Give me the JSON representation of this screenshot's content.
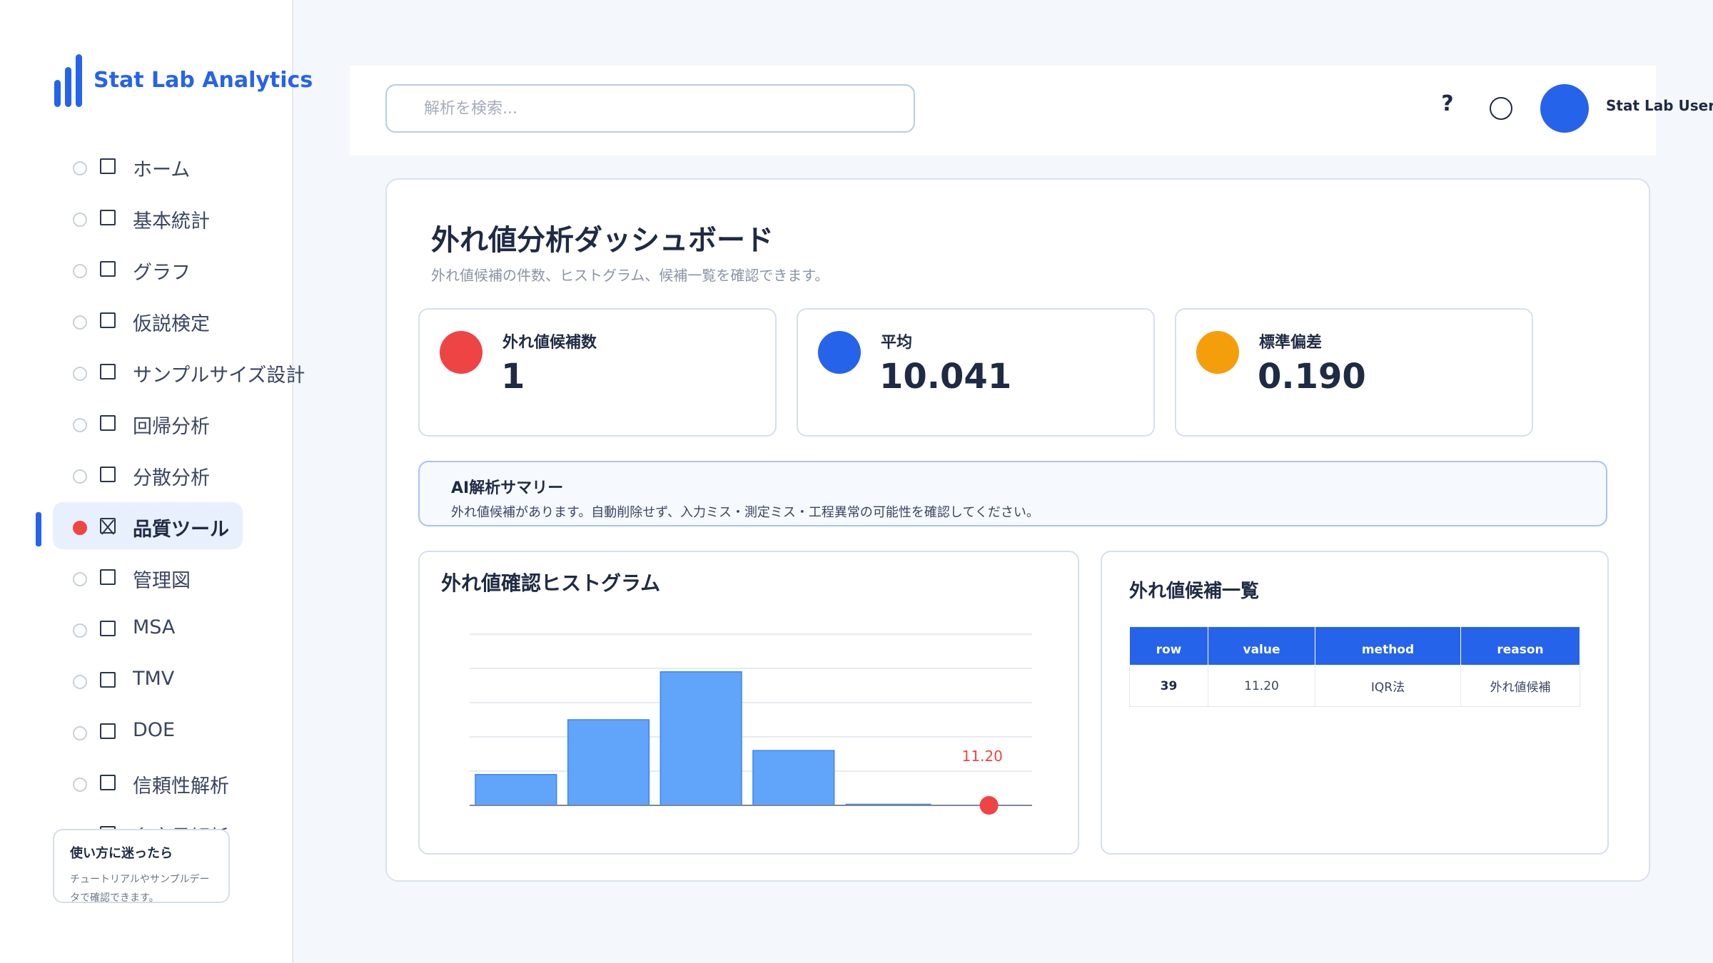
{
  "app": {
    "title": "Stat Lab Analytics"
  },
  "sidebar": {
    "items": [
      {
        "label": "ホーム",
        "active": false
      },
      {
        "label": "基本統計",
        "active": false
      },
      {
        "label": "グラフ",
        "active": false
      },
      {
        "label": "仮説検定",
        "active": false
      },
      {
        "label": "サンプルサイズ設計",
        "active": false
      },
      {
        "label": "回帰分析",
        "active": false
      },
      {
        "label": "分散分析",
        "active": false
      },
      {
        "label": "品質ツール",
        "active": true
      },
      {
        "label": "管理図",
        "active": false
      },
      {
        "label": "MSA",
        "active": false
      },
      {
        "label": "TMV",
        "active": false
      },
      {
        "label": "DOE",
        "active": false
      },
      {
        "label": "信頼性解析",
        "active": false
      },
      {
        "label": "多変量解析",
        "active": false
      }
    ],
    "help": {
      "title": "使い方に迷ったら",
      "text": "チュートリアルやサンプルデータで確認できます。"
    }
  },
  "header": {
    "search_placeholder": "解析を検索...",
    "help_icon": "?",
    "user_name": "Stat Lab User"
  },
  "colors": {
    "primary": "#2563eb",
    "danger": "#ef4444",
    "warning": "#f59e0b",
    "bar": "#60a5fa"
  },
  "dashboard": {
    "title": "外れ値分析ダッシュボード",
    "subtitle": "外れ値候補の件数、ヒストグラム、候補一覧を確認できます。",
    "stats": [
      {
        "label": "外れ値候補数",
        "value": "1",
        "color": "#ef4444"
      },
      {
        "label": "平均",
        "value": "10.041",
        "color": "#2563eb"
      },
      {
        "label": "標準偏差",
        "value": "0.190",
        "color": "#f59e0b"
      }
    ],
    "ai_summary": {
      "title": "AI解析サマリー",
      "text": "外れ値候補があります。自動削除せず、入力ミス・測定ミス・工程異常の可能性を確認してください。"
    },
    "histogram_title": "外れ値確認ヒストグラム",
    "table_title": "外れ値候補一覧",
    "table": {
      "columns": [
        "row",
        "value",
        "method",
        "reason"
      ],
      "rows": [
        {
          "row": "39",
          "value": "11.20",
          "method": "IQR法",
          "reason": "外れ値候補"
        }
      ]
    }
  },
  "chart_data": {
    "type": "bar",
    "title": "外れ値確認ヒストグラム",
    "values": [
      9,
      25,
      39,
      16,
      0,
      0
    ],
    "ylim": [
      0,
      50
    ],
    "grid": true,
    "outlier": {
      "value_label": "11.20",
      "bin_index": 5
    }
  }
}
